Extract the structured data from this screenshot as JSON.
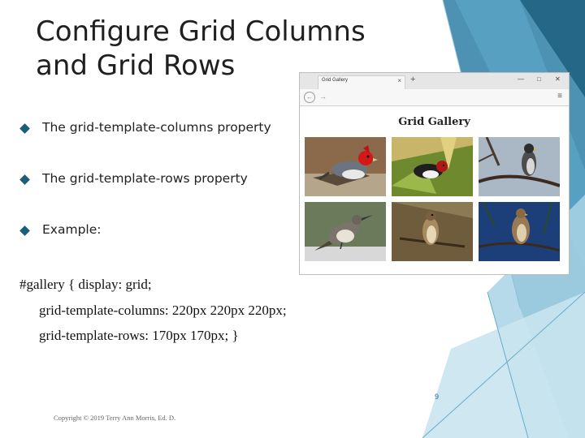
{
  "slide": {
    "title": "Configure Grid Columns and Grid Rows",
    "bullets": [
      {
        "text": "The grid-template-columns property"
      },
      {
        "text": "The grid-template-rows property"
      },
      {
        "text": "Example:"
      }
    ],
    "code_lines": [
      "#gallery { display: grid;",
      "grid-template-columns: 220px 220px 220px;",
      "grid-template-rows: 170px 170px; }"
    ],
    "page_number": "9",
    "copyright": "Copyright © 2019 Terry Ann Morris, Ed. D."
  },
  "browser": {
    "tab_label": "Grid Gallery",
    "tab_close": "×",
    "new_tab": "+",
    "heading": "Grid Gallery",
    "photos": [
      {
        "icon": "red-crested-cardinal-photo"
      },
      {
        "icon": "finch-in-grass-photo"
      },
      {
        "icon": "hawk-on-branch-photo"
      },
      {
        "icon": "mockingbird-on-rock-photo"
      },
      {
        "icon": "sparrow-hawk-photo"
      },
      {
        "icon": "hawk-blue-sky-photo"
      }
    ]
  },
  "colors": {
    "accent": "#1b5d7a",
    "deco_dark": "#2e7fa6",
    "deco_light": "#a9d3e6"
  }
}
